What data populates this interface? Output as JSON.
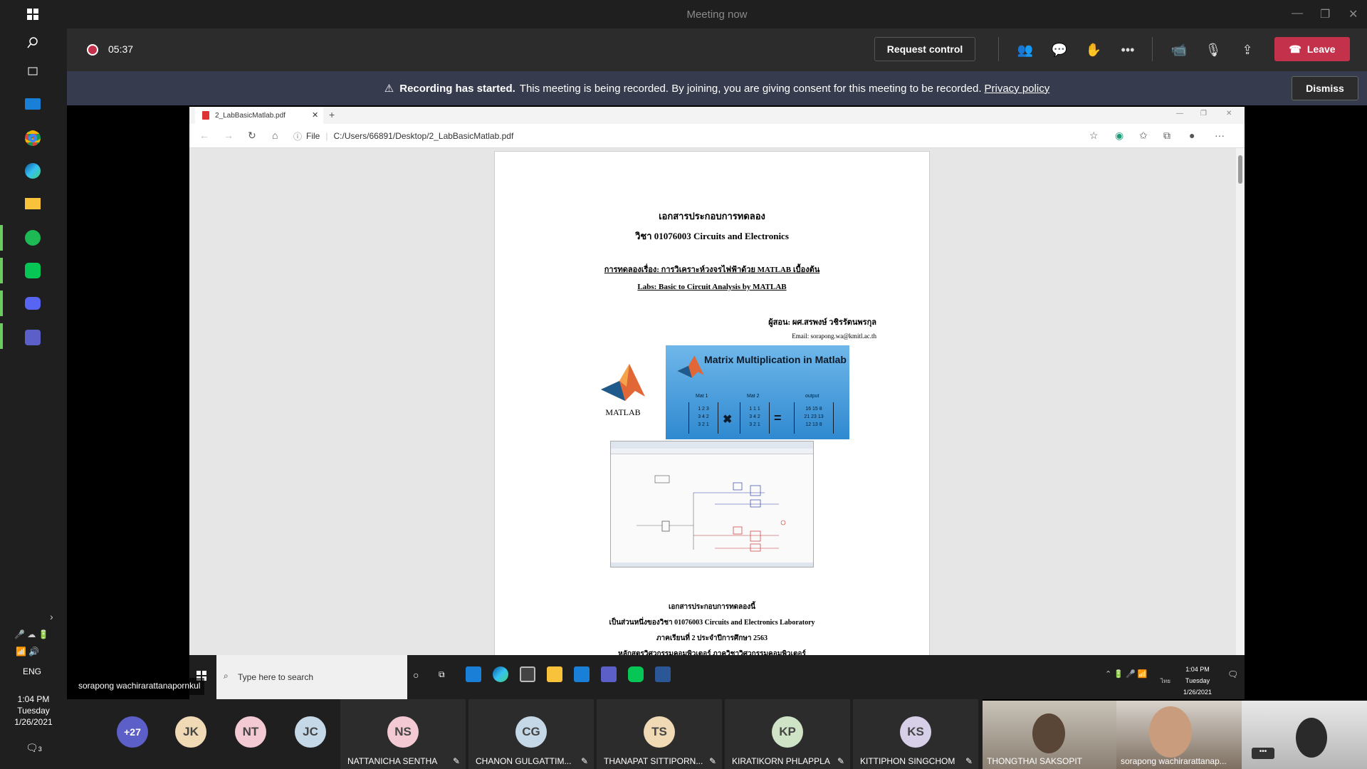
{
  "window": {
    "title": "Meeting now"
  },
  "meeting": {
    "timer": "05:37",
    "request_control": "Request control",
    "leave": "Leave"
  },
  "banner": {
    "title": "Recording has started.",
    "text": "This meeting is being recorded. By joining, you are giving consent for this meeting to be recorded.",
    "link": "Privacy policy",
    "dismiss": "Dismiss"
  },
  "browser": {
    "tab_title": "2_LabBasicMatlab.pdf",
    "file_label": "File",
    "url": "C:/Users/66891/Desktop/2_LabBasicMatlab.pdf"
  },
  "pdf": {
    "line1": "เอกสารประกอบการทดลอง",
    "line2": "วิชา 01076003 Circuits and Electronics",
    "line3": "การทดลองเรื่อง: การวิเคราะห์วงจรไฟฟ้าด้วย MATLAB เบื้องต้น",
    "line4": "Labs: Basic to Circuit Analysis by MATLAB",
    "author": "ผู้สอน: ผศ.สรพงษ์ วชิรรัตนพรกุล",
    "email": "Email: sorapong.wa@kmitl.ac.th",
    "matlab_label": "MATLAB",
    "banner_title": "Matrix Multiplication in Matlab",
    "mat1": "Mat 1",
    "mat2": "Mat 2",
    "output": "output",
    "m1": [
      "1 2 3",
      "3 4 2",
      "3 2 1"
    ],
    "m2": [
      "1 1 1",
      "3 4 2",
      "3 2 1"
    ],
    "mo": [
      "16 15 8",
      "21 23 13",
      "12 13 8"
    ],
    "b1": "เอกสารประกอบการทดลองนี้",
    "b2": "เป็นส่วนหนึ่งของวิชา 01076003 Circuits and Electronics Laboratory",
    "b3": "ภาคเรียนที่ 2      ประจำปีการศึกษา 2563",
    "b4": "หลักสูตรวิศวกรรมคอมพิวเตอร์  ภาควิชาวิศวกรรมคอมพิวเตอร์"
  },
  "inner_taskbar": {
    "search_placeholder": "Type here to search",
    "time": "1:04 PM",
    "day": "Tuesday",
    "date": "1/26/2021",
    "lang": "ไทย"
  },
  "outer_taskbar": {
    "lang": "ENG",
    "time": "1:04 PM",
    "day": "Tuesday",
    "date": "1/26/2021",
    "notif_count": "3"
  },
  "presenter": "sorapong wachirarattanapornkul",
  "participants": {
    "overflow": "+27",
    "avatars": [
      {
        "initials": "JK",
        "color": "#f0d9b5"
      },
      {
        "initials": "NT",
        "color": "#f3c9d3"
      },
      {
        "initials": "JC",
        "color": "#c5d8e8"
      }
    ],
    "cards": [
      {
        "initials": "NS",
        "name": "NATTANICHA SENTHA",
        "color": "#f3c9d3"
      },
      {
        "initials": "CG",
        "name": "CHANON GULGATTIM...",
        "color": "#c5d8e8"
      },
      {
        "initials": "TS",
        "name": "THANAPAT SITTIPORN...",
        "color": "#f0d9b5"
      },
      {
        "initials": "KP",
        "name": "KIRATIKORN PHLAPPLA",
        "color": "#cfe3c6"
      },
      {
        "initials": "KS",
        "name": "KITTIPHON SINGCHOM",
        "color": "#d7cfe8"
      }
    ],
    "videos": [
      "THONGTHAI SAKSOPIT",
      "sorapong wachirarattanap..."
    ]
  }
}
